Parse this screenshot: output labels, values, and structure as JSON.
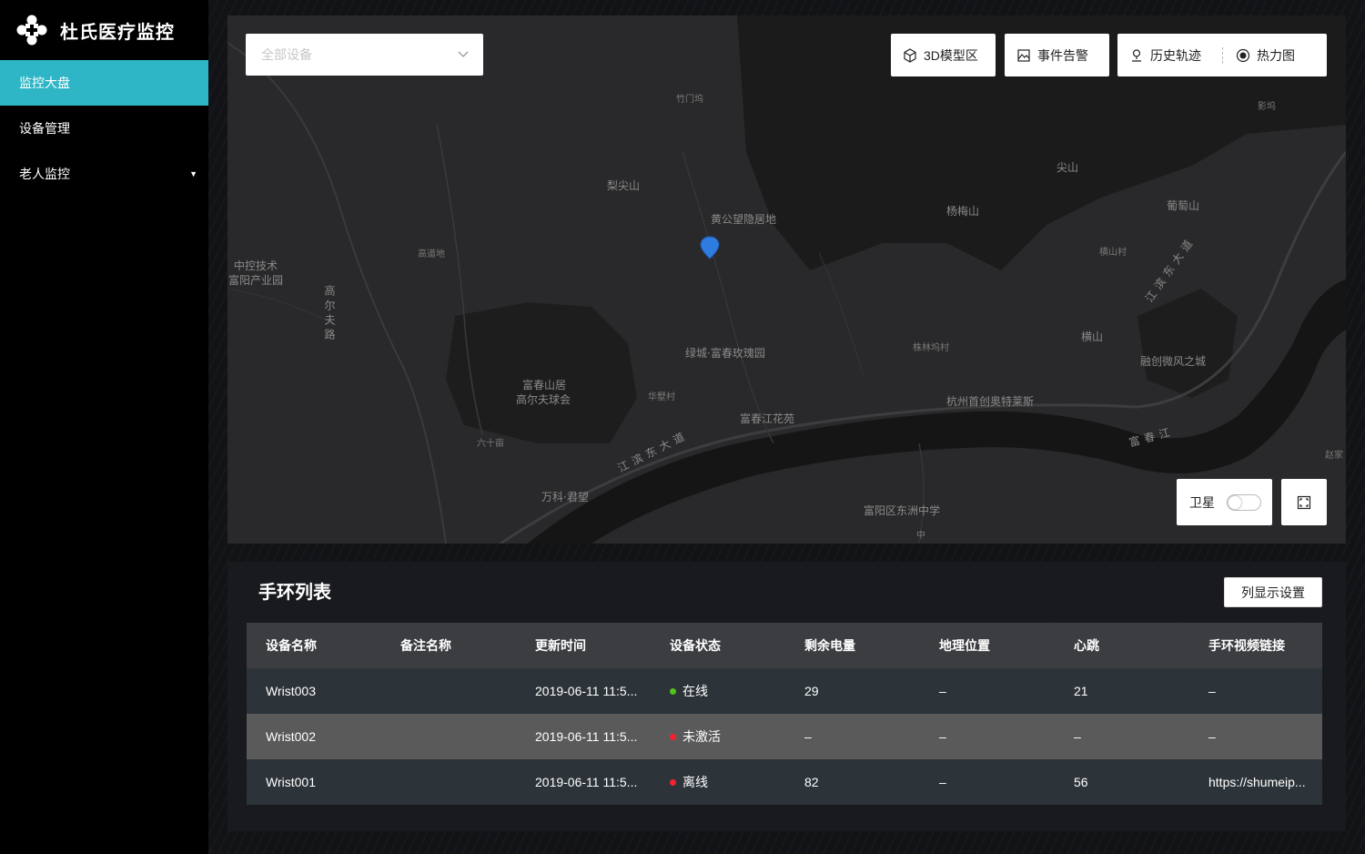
{
  "app": {
    "title": "杜氏医疗监控"
  },
  "sidebar": {
    "items": [
      {
        "label": "监控大盘",
        "active": true
      },
      {
        "label": "设备管理",
        "active": false
      },
      {
        "label": "老人监控",
        "active": false,
        "has_submenu": true
      }
    ]
  },
  "map": {
    "device_select": {
      "placeholder": "全部设备"
    },
    "buttons": {
      "model_3d": "3D模型区",
      "alarm": "事件告警",
      "history": "历史轨迹",
      "heatmap": "热力图"
    },
    "satellite": {
      "label": "卫星",
      "enabled": false
    },
    "labels": [
      "竹门坞",
      "梨尖山",
      "黄公望隐居地",
      "尖山",
      "杨梅山",
      "葡萄山",
      "影坞",
      "横山村",
      "中控技术",
      "富阳产业园",
      "高道地",
      "高尔夫路",
      "绿城·富春玫瑰园",
      "株林坞村",
      "横山",
      "融创微风之城",
      "富春山居",
      "高尔夫球会",
      "华墅村",
      "杭州首创奥特莱斯",
      "富春江花苑",
      "六十亩",
      "江滨东大道",
      "富春江",
      "赵家",
      "万科·君望",
      "富阳区东洲中学",
      "中",
      "江滨东大道"
    ],
    "marker_color": "#2f7ce0"
  },
  "table": {
    "title": "手环列表",
    "settings_button": "列显示设置",
    "columns": [
      "设备名称",
      "备注名称",
      "更新时间",
      "设备状态",
      "剩余电量",
      "地理位置",
      "心跳",
      "手环视频链接"
    ],
    "rows": [
      {
        "name": "Wrist003",
        "remark": "",
        "time": "2019-06-11 11:5...",
        "status": "在线",
        "status_color": "#52c41a",
        "battery": "29",
        "location": "–",
        "heartbeat": "21",
        "video": "–"
      },
      {
        "name": "Wrist002",
        "remark": "",
        "time": "2019-06-11 11:5...",
        "status": "未激活",
        "status_color": "#f5222d",
        "battery": "–",
        "location": "–",
        "heartbeat": "–",
        "video": "–"
      },
      {
        "name": "Wrist001",
        "remark": "",
        "time": "2019-06-11 11:5...",
        "status": "离线",
        "status_color": "#f5222d",
        "battery": "82",
        "location": "–",
        "heartbeat": "56",
        "video": "https://shumeip..."
      }
    ]
  },
  "colors": {
    "accent": "#2eb6c6",
    "sidebar_bg": "#000000",
    "map_bg": "#29292b"
  }
}
